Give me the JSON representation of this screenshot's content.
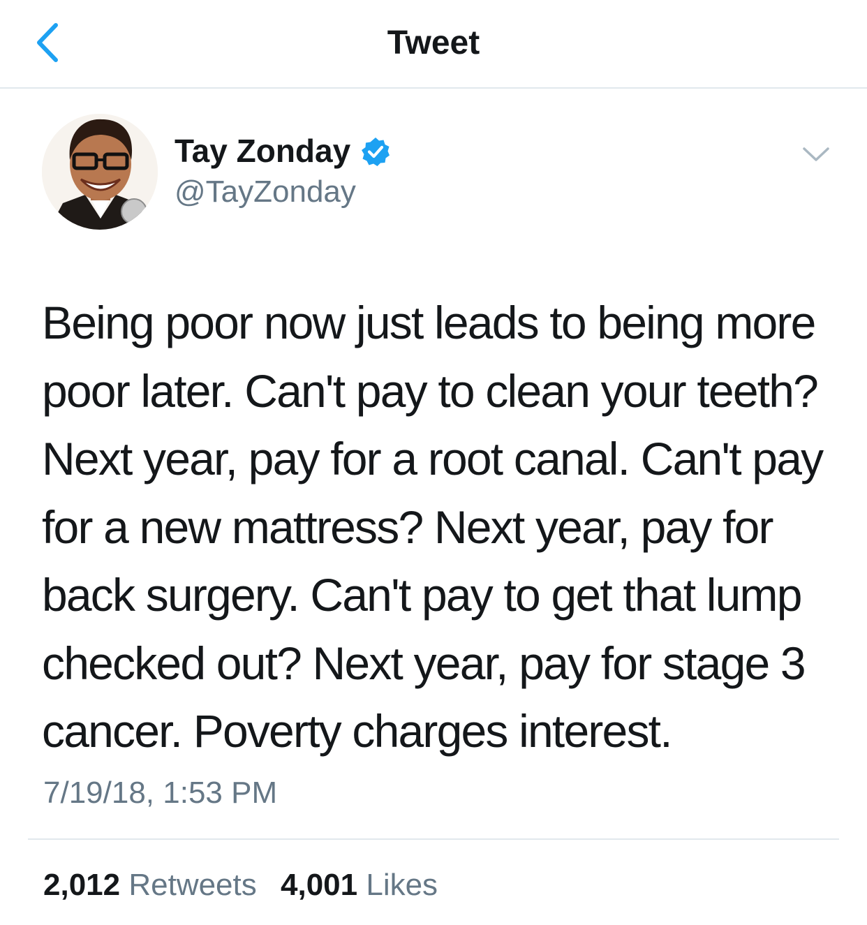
{
  "nav": {
    "title": "Tweet",
    "back_icon": "chevron-left-icon"
  },
  "colors": {
    "accent": "#1da1f2",
    "text_primary": "#14171a",
    "text_secondary": "#657786",
    "divider": "#e1e8ed"
  },
  "author": {
    "name": "Tay Zonday",
    "handle": "@TayZonday",
    "verified": true,
    "verified_icon": "verified-badge-icon",
    "menu_icon": "chevron-down-icon"
  },
  "tweet": {
    "text": "Being poor now just leads to being more poor later. Can't pay to clean your teeth? Next year, pay for a root canal. Can't pay for a new mattress? Next year, pay for back surgery. Can't pay to get that lump checked out? Next year, pay for stage 3 cancer. Poverty charges interest.",
    "timestamp": "7/19/18, 1:53 PM"
  },
  "stats": {
    "retweets_count": "2,012",
    "retweets_label": "Retweets",
    "likes_count": "4,001",
    "likes_label": "Likes"
  }
}
